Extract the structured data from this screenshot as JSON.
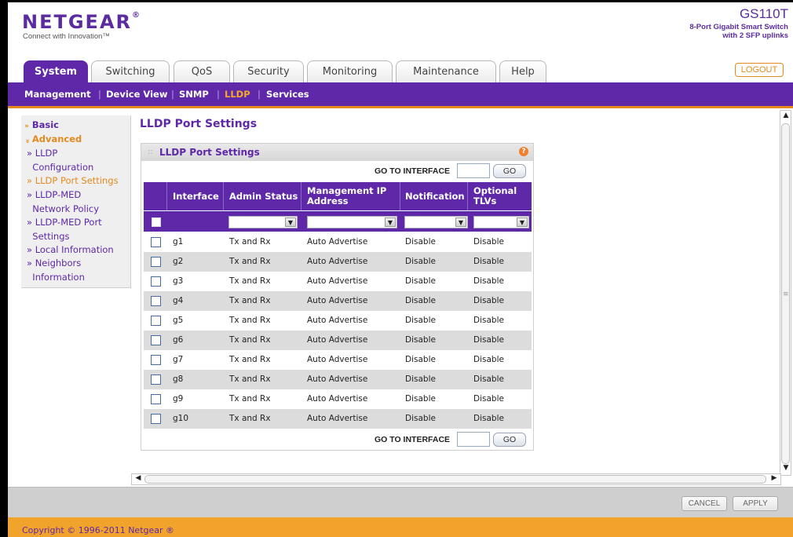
{
  "header": {
    "logo": "NETGEAR",
    "logo_mark": "®",
    "tagline": "Connect with Innovation™",
    "model": "GS110T",
    "model_desc": "8-Port Gigabit Smart Switch\nwith 2 SFP uplinks",
    "logout": "LOGOUT"
  },
  "tabs": [
    {
      "label": "System",
      "active": true
    },
    {
      "label": "Switching"
    },
    {
      "label": "QoS"
    },
    {
      "label": "Security"
    },
    {
      "label": "Monitoring"
    },
    {
      "label": "Maintenance"
    },
    {
      "label": "Help"
    }
  ],
  "subnav": [
    {
      "label": "Management"
    },
    {
      "label": "Device View"
    },
    {
      "label": "SNMP"
    },
    {
      "label": "LLDP",
      "active": true
    },
    {
      "label": "Services"
    }
  ],
  "subnav_sep": "|",
  "sidemenu": {
    "basic": "Basic",
    "basic_icon": "»",
    "advanced": "Advanced",
    "advanced_icon": "»",
    "items": [
      {
        "label": "» LLDP\n  Configuration"
      },
      {
        "label": "» LLDP Port Settings",
        "active": true
      },
      {
        "label": "» LLDP-MED\n  Network Policy"
      },
      {
        "label": "» LLDP-MED Port\n  Settings"
      },
      {
        "label": "» Local Information"
      },
      {
        "label": "» Neighbors\n  Information"
      }
    ]
  },
  "page_title": "LLDP Port Settings",
  "panel": {
    "title": "LLDP Port Settings",
    "grip": "::",
    "help": "?",
    "goto_label": "GO TO INTERFACE",
    "go_button": "GO",
    "goto_value": ""
  },
  "table": {
    "headers": [
      "Interface",
      "Admin Status",
      "Management IP Address",
      "Notification",
      "Optional TLVs"
    ],
    "filters": [
      "",
      "",
      "",
      ""
    ],
    "dropdown_glyph": "▼",
    "rows": [
      {
        "interface": "g1",
        "admin": "Tx and Rx",
        "mgmt_ip": "Auto Advertise",
        "notification": "Disable",
        "tlvs": "Disable"
      },
      {
        "interface": "g2",
        "admin": "Tx and Rx",
        "mgmt_ip": "Auto Advertise",
        "notification": "Disable",
        "tlvs": "Disable"
      },
      {
        "interface": "g3",
        "admin": "Tx and Rx",
        "mgmt_ip": "Auto Advertise",
        "notification": "Disable",
        "tlvs": "Disable"
      },
      {
        "interface": "g4",
        "admin": "Tx and Rx",
        "mgmt_ip": "Auto Advertise",
        "notification": "Disable",
        "tlvs": "Disable"
      },
      {
        "interface": "g5",
        "admin": "Tx and Rx",
        "mgmt_ip": "Auto Advertise",
        "notification": "Disable",
        "tlvs": "Disable"
      },
      {
        "interface": "g6",
        "admin": "Tx and Rx",
        "mgmt_ip": "Auto Advertise",
        "notification": "Disable",
        "tlvs": "Disable"
      },
      {
        "interface": "g7",
        "admin": "Tx and Rx",
        "mgmt_ip": "Auto Advertise",
        "notification": "Disable",
        "tlvs": "Disable"
      },
      {
        "interface": "g8",
        "admin": "Tx and Rx",
        "mgmt_ip": "Auto Advertise",
        "notification": "Disable",
        "tlvs": "Disable"
      },
      {
        "interface": "g9",
        "admin": "Tx and Rx",
        "mgmt_ip": "Auto Advertise",
        "notification": "Disable",
        "tlvs": "Disable"
      },
      {
        "interface": "g10",
        "admin": "Tx and Rx",
        "mgmt_ip": "Auto Advertise",
        "notification": "Disable",
        "tlvs": "Disable"
      }
    ]
  },
  "scroll": {
    "up": "▲",
    "down": "▼",
    "left": "◀",
    "right": "▶",
    "grip": "≡"
  },
  "buttons": {
    "cancel": "CANCEL",
    "apply": "APPLY"
  },
  "footer": {
    "copyright": "Copyright © 1996-2011 Netgear ®"
  },
  "colors": {
    "purple": "#5e28a8",
    "orange": "#e28a1e",
    "row_alt": "#dcdcdc"
  }
}
